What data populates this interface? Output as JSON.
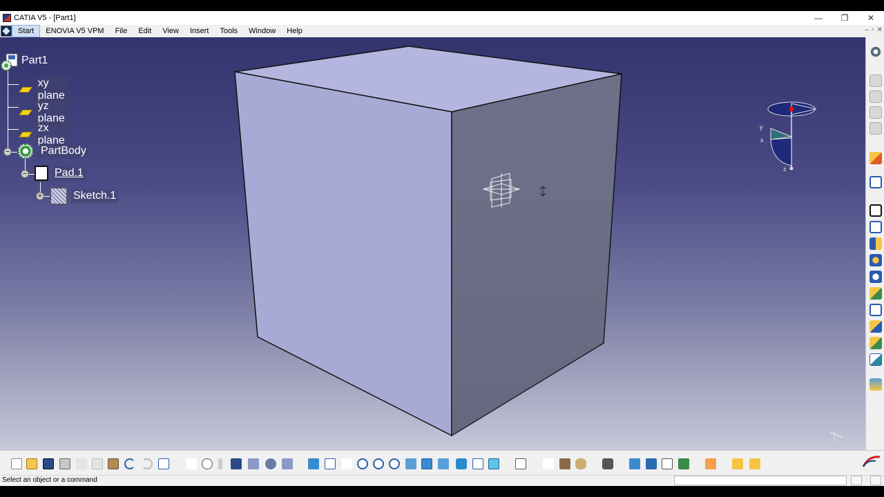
{
  "window": {
    "title": "CATIA V5 - [Part1]",
    "min_glyph": "—",
    "restore_glyph": "❐",
    "close_glyph": "✕"
  },
  "menu": {
    "items": [
      {
        "label": "Start",
        "name": "menu-start"
      },
      {
        "label": "ENOVIA V5 VPM",
        "name": "menu-enovia"
      },
      {
        "label": "File",
        "name": "menu-file"
      },
      {
        "label": "Edit",
        "name": "menu-edit"
      },
      {
        "label": "View",
        "name": "menu-view"
      },
      {
        "label": "Insert",
        "name": "menu-insert"
      },
      {
        "label": "Tools",
        "name": "menu-tools"
      },
      {
        "label": "Window",
        "name": "menu-window"
      },
      {
        "label": "Help",
        "name": "menu-help"
      }
    ],
    "mdi_min": "–",
    "mdi_restore": "▫",
    "mdi_close": "✕"
  },
  "tree": {
    "root": "Part1",
    "xy_plane": "xy plane",
    "yz_plane": "yz plane",
    "zx_plane": "zx plane",
    "body": "PartBody",
    "pad": "Pad.1",
    "sketch": "Sketch.1",
    "collapse_glyph": "−",
    "expand_glyph": "+"
  },
  "compass": {
    "x": "x",
    "y": "y",
    "z": "z"
  },
  "status": {
    "message": "Select an object or a command"
  },
  "colors": {
    "viewport_top": "#33336e",
    "viewport_bottom": "#c7c8d8",
    "cube_top": "#b4b6e0",
    "cube_front": "#a8aad6",
    "cube_right": "#6e6f88",
    "plane_yellow": "#f2d31a"
  }
}
